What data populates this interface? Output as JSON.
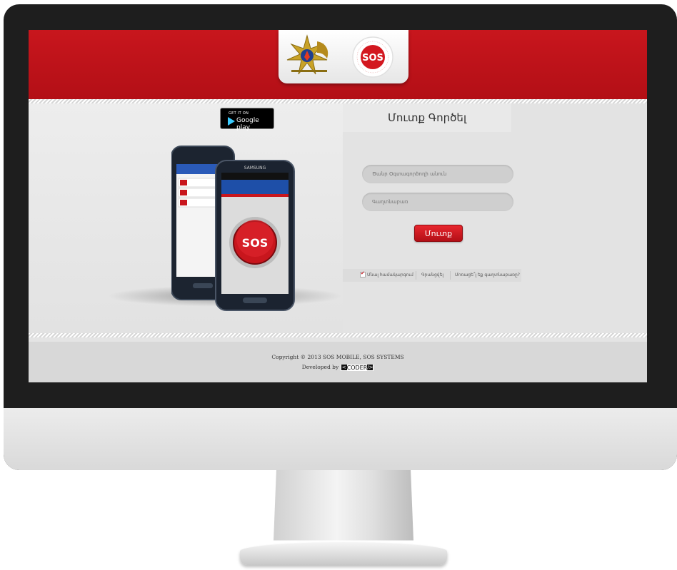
{
  "header": {
    "emblem_icon": "fire-rescue-emblem-icon",
    "sos_logo_text": "SOS",
    "brand_red": "#c8161d"
  },
  "promo": {
    "google_play_small": "GET IT ON",
    "google_play_big": "Google play",
    "phone_sos_text": "SOS",
    "phone_brand": "SAMSUNG"
  },
  "login": {
    "title": "Մուտք Գործել",
    "username_placeholder": "Ծանր Օգտագործողի անուն",
    "password_placeholder": "Գաղտնաբառ",
    "submit_label": "Մուտք",
    "remember_label": "Մնալ համակարգում",
    "register_label": "Գրանցվել",
    "forgot_label": "Մոռացե՞լ եք գաղտնաբառը?"
  },
  "footer": {
    "copyright": "Copyright © 2013 SOS MOBILE, SOS SYSTEMS",
    "developed_by": "Developed by",
    "coder_brand": "CODER"
  }
}
